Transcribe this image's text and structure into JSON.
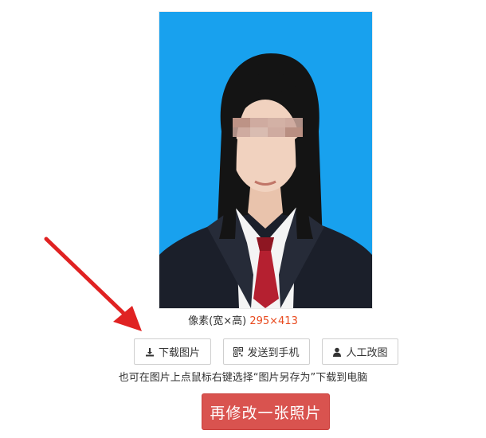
{
  "photo": {
    "background_color": "#18a1ee"
  },
  "pixel_info": {
    "label": "像素(宽×高)",
    "dimensions": "295×413"
  },
  "buttons": {
    "download": {
      "label": "下载图片",
      "icon": "download-icon"
    },
    "send": {
      "label": "发送到手机",
      "icon": "qrcode-icon"
    },
    "manual": {
      "label": "人工改图",
      "icon": "user-icon"
    }
  },
  "hint": "也可在图片上点鼠标右键选择“图片另存为”下载到电脑",
  "retake_button": {
    "label": "再修改一张照片"
  },
  "colors": {
    "accent_red": "#d9534f",
    "dims_text": "#e8491d",
    "arrow": "#e02222"
  }
}
